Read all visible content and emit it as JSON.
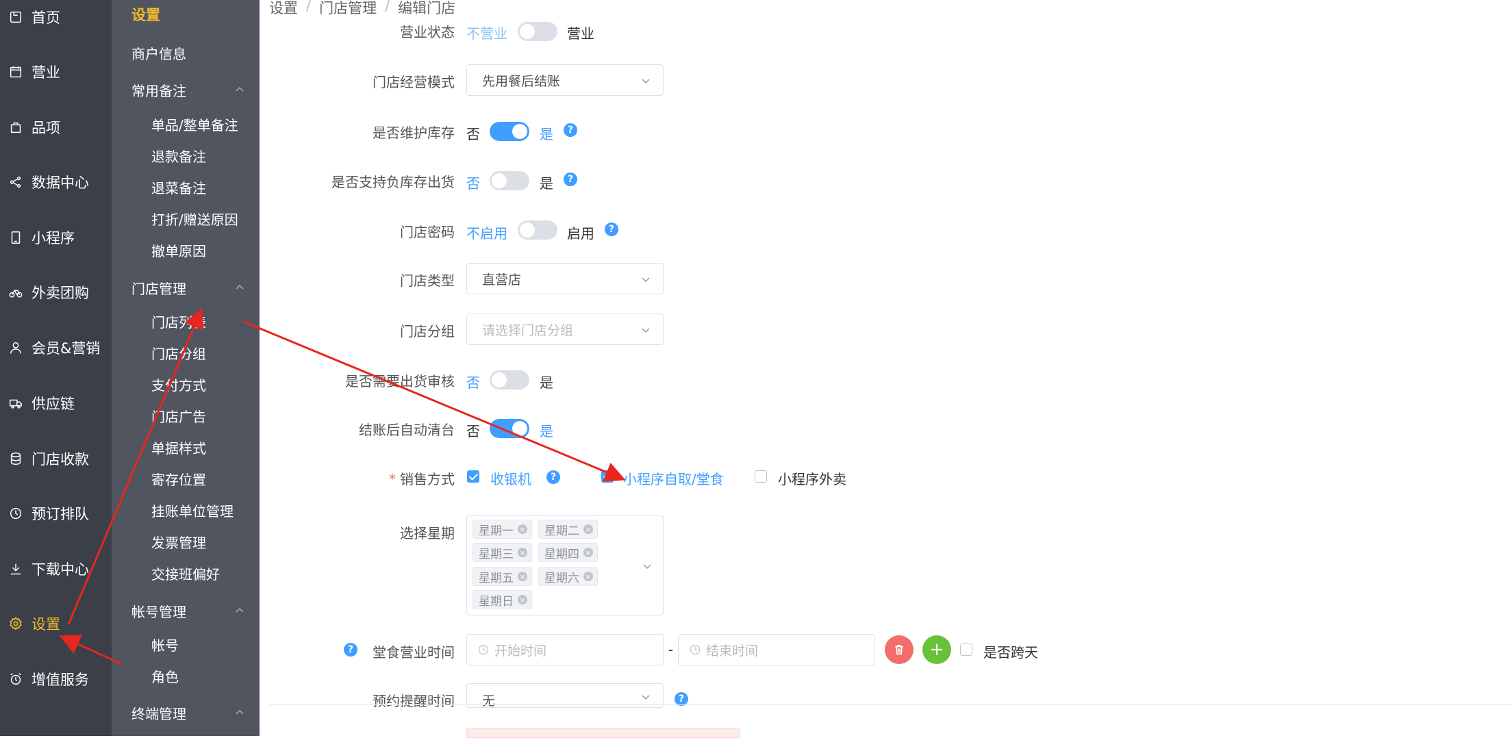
{
  "nav_primary": [
    {
      "label": "首页",
      "icon": "home-icon"
    },
    {
      "label": "营业",
      "icon": "calendar-icon"
    },
    {
      "label": "品项",
      "icon": "bag-icon"
    },
    {
      "label": "数据中心",
      "icon": "share-icon"
    },
    {
      "label": "小程序",
      "icon": "tablet-icon"
    },
    {
      "label": "外卖团购",
      "icon": "bike-icon"
    },
    {
      "label": "会员&营销",
      "icon": "user-icon"
    },
    {
      "label": "供应链",
      "icon": "truck-icon"
    },
    {
      "label": "门店收款",
      "icon": "coins-icon"
    },
    {
      "label": "预订排队",
      "icon": "clock-icon"
    },
    {
      "label": "下载中心",
      "icon": "download-icon"
    },
    {
      "label": "设置",
      "icon": "gear-icon",
      "active": true
    },
    {
      "label": "增值服务",
      "icon": "alarm-clock-icon"
    }
  ],
  "nav_secondary": {
    "title": "设置",
    "merchant": "商户信息",
    "groups": [
      {
        "label": "常用备注",
        "items": [
          "单品/整单备注",
          "退款备注",
          "退菜备注",
          "打折/赠送原因",
          "撤单原因"
        ]
      },
      {
        "label": "门店管理",
        "items": [
          "门店列表",
          "门店分组",
          "支付方式",
          "门店广告",
          "单据样式",
          "寄存位置",
          "挂账单位管理",
          "发票管理",
          "交接班偏好"
        ]
      },
      {
        "label": "帐号管理",
        "items": [
          "帐号",
          "角色"
        ]
      },
      {
        "label": "终端管理",
        "items": []
      }
    ]
  },
  "breadcrumb": [
    "设置",
    "门店管理",
    "编辑门店"
  ],
  "breadcrumb_sep": "/",
  "form": {
    "business_status": {
      "label": "营业状态",
      "off": "不营业",
      "on": "营业"
    },
    "mode": {
      "label": "门店经营模式",
      "value": "先用餐后结账"
    },
    "inventory": {
      "label": "是否维护库存",
      "off": "否",
      "on": "是"
    },
    "negative_stock": {
      "label": "是否支持负库存出货",
      "off": "否",
      "on": "是"
    },
    "password": {
      "label": "门店密码",
      "off": "不启用",
      "on": "启用"
    },
    "store_type": {
      "label": "门店类型",
      "value": "直营店"
    },
    "store_group": {
      "label": "门店分组",
      "placeholder": "请选择门店分组"
    },
    "ship_review": {
      "label": "是否需要出货审核",
      "off": "否",
      "on": "是"
    },
    "auto_clear": {
      "label": "结账后自动清台",
      "off": "否",
      "on": "是"
    },
    "sales": {
      "label": "销售方式",
      "required": "*",
      "options": [
        "收银机",
        "小程序自取/堂食",
        "小程序外卖"
      ]
    },
    "weekdays": {
      "label": "选择星期",
      "tags": [
        "星期一",
        "星期二",
        "星期三",
        "星期四",
        "星期五",
        "星期六",
        "星期日"
      ]
    },
    "dine_hours": {
      "label": "堂食营业时间",
      "start": "开始时间",
      "end": "结束时间",
      "dash": "-",
      "cross_day": "是否跨天"
    },
    "reminder": {
      "label": "预约提醒时间",
      "value": "无"
    }
  },
  "help_mark": "?",
  "tag_close": "×",
  "delete_glyph": "🗑",
  "add_glyph": "+",
  "colors": {
    "primary": "#409eff",
    "active_nav": "#f5b930",
    "nav_bg": "#3a3f48",
    "subnav_bg": "#50555f",
    "danger": "#f56c6c",
    "success": "#67c23a",
    "arrow": "#e8261f"
  }
}
